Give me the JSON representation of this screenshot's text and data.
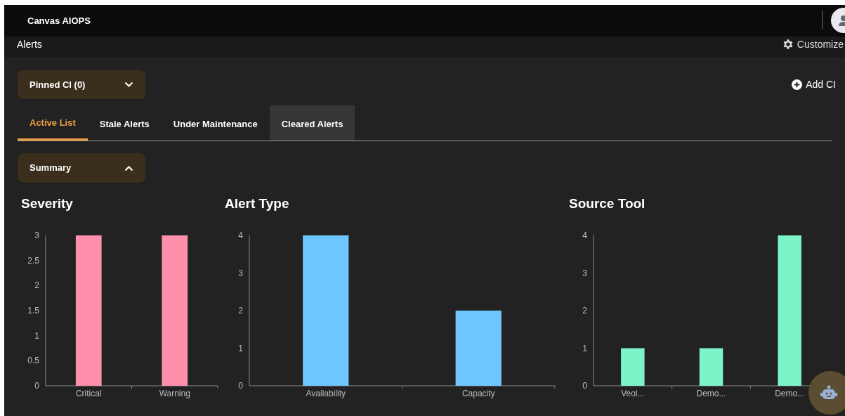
{
  "app": {
    "title": "Canvas AIOPS"
  },
  "header": {
    "title": "Alerts",
    "customize_label": "Customize"
  },
  "pinned": {
    "label": "Pinned CI (0)",
    "expanded": false
  },
  "add_ci": {
    "label": "Add CI"
  },
  "tabs": [
    {
      "label": "Active List",
      "selected": true,
      "highlighted": false
    },
    {
      "label": "Stale Alerts",
      "selected": false,
      "highlighted": false
    },
    {
      "label": "Under Maintenance",
      "selected": false,
      "highlighted": false
    },
    {
      "label": "Cleared Alerts",
      "selected": false,
      "highlighted": true
    }
  ],
  "summary": {
    "label": "Summary",
    "expanded": true
  },
  "charts": [
    {
      "chart_data": {
        "type": "bar",
        "title": "Severity",
        "categories": [
          "Critical",
          "Warning"
        ],
        "series": [
          {
            "color": "#ff8fab",
            "values": [
              3,
              3
            ]
          }
        ],
        "ylim": [
          0,
          3
        ],
        "yticks": [
          0,
          0.5,
          1,
          1.5,
          2,
          2.5,
          3
        ]
      }
    },
    {
      "chart_data": {
        "type": "bar",
        "title": "Alert Type",
        "categories": [
          "Availability",
          "Capacity"
        ],
        "series": [
          {
            "color": "#6ec6ff",
            "values": [
              4,
              2
            ]
          }
        ],
        "ylim": [
          0,
          4
        ],
        "yticks": [
          0,
          1,
          2,
          3,
          4
        ]
      }
    },
    {
      "chart_data": {
        "type": "bar",
        "title": "Source Tool",
        "categories": [
          "Veol...",
          "Demo...",
          "Demo..."
        ],
        "series": [
          {
            "color": "#7df3c8",
            "values": [
              1,
              1,
              4
            ]
          }
        ],
        "ylim": [
          0,
          4
        ],
        "yticks": [
          0,
          1,
          2,
          3,
          4
        ]
      }
    }
  ]
}
